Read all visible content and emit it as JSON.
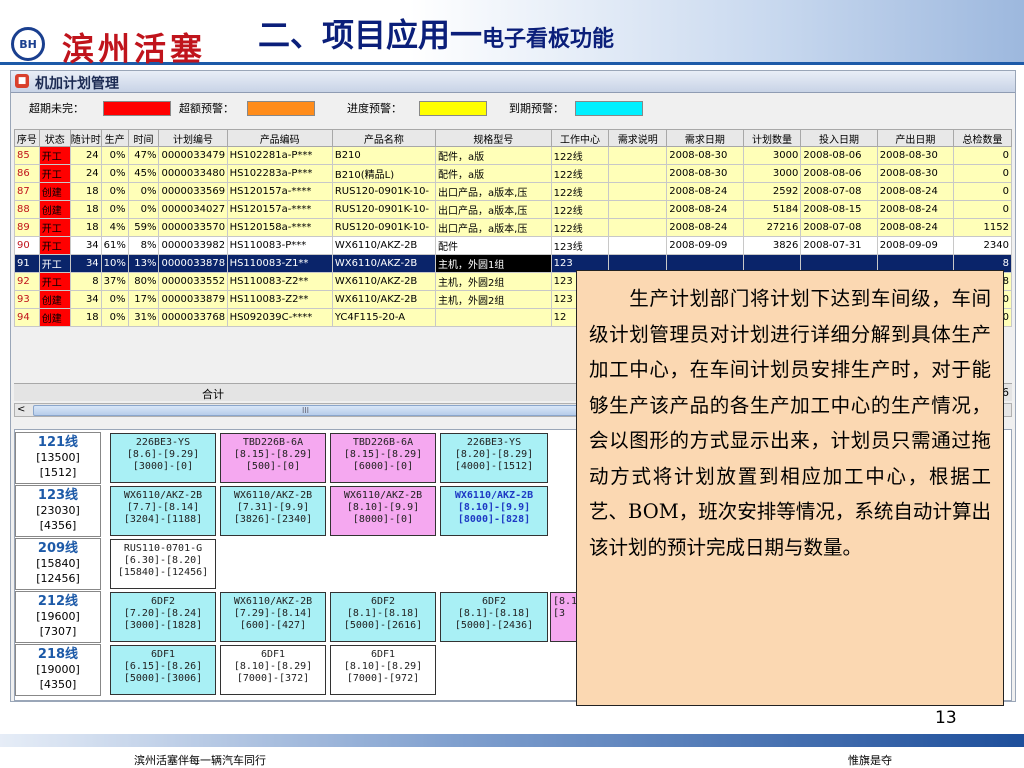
{
  "slide": {
    "logo_badge": "BH",
    "logo_text": "滨州活塞",
    "title_main": "二、项目应用一",
    "title_sub": "电子看板功能",
    "page_number": "13",
    "footer_left": "滨州活塞伴每一辆汽车同行",
    "footer_right": "惟旗是夺"
  },
  "app": {
    "window_title": "机加计划管理",
    "legend": [
      {
        "label": "超期未完：",
        "color": "#ff0000"
      },
      {
        "label": "超额预警：",
        "color": "#ff8c1a"
      },
      {
        "label": "进度预警：",
        "color": "#ffff00"
      },
      {
        "label": "到期预警：",
        "color": "#00f0ff"
      }
    ],
    "columns": [
      "序号",
      "状态",
      "随计时",
      "生产",
      "时间",
      "计划编号",
      "产品编码",
      "产品名称",
      "规格型号",
      "工作中心",
      "需求说明",
      "需求日期",
      "计划数量",
      "投入日期",
      "产出日期",
      "总检数量"
    ],
    "rows": [
      {
        "no": "85",
        "status": "开工",
        "h": "24",
        "prod": "0%",
        "time": "47%",
        "plan": "0000033479",
        "code": "HS102281a-P***",
        "name": "B210",
        "spec": "配件，a版",
        "center": "122线",
        "req": "",
        "due": "2008-08-30",
        "qty": "3000",
        "start": "2008-08-06",
        "end": "2008-08-30",
        "chk": "0"
      },
      {
        "no": "86",
        "status": "开工",
        "h": "24",
        "prod": "0%",
        "time": "45%",
        "plan": "0000033480",
        "code": "HS102283a-P***",
        "name": "B210(精品L)",
        "spec": "配件，a版",
        "center": "122线",
        "req": "",
        "due": "2008-08-30",
        "qty": "3000",
        "start": "2008-08-06",
        "end": "2008-08-30",
        "chk": "0"
      },
      {
        "no": "87",
        "status": "创建",
        "h": "18",
        "prod": "0%",
        "time": "0%",
        "plan": "0000033569",
        "code": "HS120157a-****",
        "name": "RUS120-0901K-10-",
        "spec": "出口产品，a版本,压",
        "center": "122线",
        "req": "",
        "due": "2008-08-24",
        "qty": "2592",
        "start": "2008-07-08",
        "end": "2008-08-24",
        "chk": "0"
      },
      {
        "no": "88",
        "status": "创建",
        "h": "18",
        "prod": "0%",
        "time": "0%",
        "plan": "0000034027",
        "code": "HS120157a-****",
        "name": "RUS120-0901K-10-",
        "spec": "出口产品，a版本,压",
        "center": "122线",
        "req": "",
        "due": "2008-08-24",
        "qty": "5184",
        "start": "2008-08-15",
        "end": "2008-08-24",
        "chk": "0"
      },
      {
        "no": "89",
        "status": "开工",
        "h": "18",
        "prod": "4%",
        "time": "59%",
        "plan": "0000033570",
        "code": "HS120158a-****",
        "name": "RUS120-0901K-10-",
        "spec": "出口产品，a版本,压",
        "center": "122线",
        "req": "",
        "due": "2008-08-24",
        "qty": "27216",
        "start": "2008-07-08",
        "end": "2008-08-24",
        "chk": "1152"
      },
      {
        "no": "90",
        "status": "开工",
        "h": "34",
        "prod": "61%",
        "time": "8%",
        "plan": "0000033982",
        "code": "HS110083-P***",
        "name": "WX6110/AKZ-2B",
        "spec": "配件",
        "center": "123线",
        "req": "",
        "due": "2008-09-09",
        "qty": "3826",
        "start": "2008-07-31",
        "end": "2008-09-09",
        "chk": "2340"
      },
      {
        "no": "91",
        "status": "开工",
        "h": "34",
        "prod": "10%",
        "time": "13%",
        "plan": "0000033878",
        "code": "HS110083-Z1**",
        "name": "WX6110/AKZ-2B",
        "spec": "主机，外圆1组",
        "center": "123",
        "req": "",
        "due": "",
        "qty": "",
        "start": "",
        "end": "",
        "chk": "8"
      },
      {
        "no": "92",
        "status": "开工",
        "h": "8",
        "prod": "37%",
        "time": "80%",
        "plan": "0000033552",
        "code": "HS110083-Z2**",
        "name": "WX6110/AKZ-2B",
        "spec": "主机，外圆2组",
        "center": "123",
        "req": "",
        "due": "",
        "qty": "",
        "start": "",
        "end": "",
        "chk": "8"
      },
      {
        "no": "93",
        "status": "创建",
        "h": "34",
        "prod": "0%",
        "time": "17%",
        "plan": "0000033879",
        "code": "HS110083-Z2**",
        "name": "WX6110/AKZ-2B",
        "spec": "主机，外圆2组",
        "center": "123",
        "req": "",
        "due": "",
        "qty": "",
        "start": "",
        "end": "",
        "chk": "0"
      },
      {
        "no": "94",
        "status": "创建",
        "h": "18",
        "prod": "0%",
        "time": "31%",
        "plan": "0000033768",
        "code": "HS092039C-****",
        "name": "YC4F115-20-A",
        "spec": "",
        "center": "12",
        "req": "",
        "due": "",
        "qty": "",
        "start": "",
        "end": "",
        "chk": "0"
      }
    ],
    "sum_label": "合计",
    "sum_value": "6",
    "scroll_grip": "III",
    "scroll_left": "<",
    "board": {
      "lines": [
        {
          "name": "121线",
          "a": "[13500]",
          "b": "[1512]"
        },
        {
          "name": "123线",
          "a": "[23030]",
          "b": "[4356]"
        },
        {
          "name": "209线",
          "a": "[15840]",
          "b": "[12456]"
        },
        {
          "name": "212线",
          "a": "[19600]",
          "b": "[7307]"
        },
        {
          "name": "218线",
          "a": "[19000]",
          "b": "[4350]"
        }
      ],
      "cards": [
        {
          "l1": "226BE3-YS",
          "l2": "[8.6]-[9.29]",
          "l3": "[3000]-[0]"
        },
        {
          "l1": "TBD226B-6A",
          "l2": "[8.15]-[8.29]",
          "l3": "[500]-[0]"
        },
        {
          "l1": "TBD226B-6A",
          "l2": "[8.15]-[8.29]",
          "l3": "[6000]-[0]"
        },
        {
          "l1": "226BE3-YS",
          "l2": "[8.20]-[8.29]",
          "l3": "[4000]-[1512]"
        },
        {
          "l1": "WX6110/AKZ-2B",
          "l2": "[7.7]-[8.14]",
          "l3": "[3204]-[1188]"
        },
        {
          "l1": "WX6110/AKZ-2B",
          "l2": "[7.31]-[9.9]",
          "l3": "[3826]-[2340]"
        },
        {
          "l1": "WX6110/AKZ-2B",
          "l2": "[8.10]-[9.9]",
          "l3": "[8000]-[0]"
        },
        {
          "l1": "WX6110/AKZ-2B",
          "l2": "[8.10]-[9.9]",
          "l3": "[8000]-[828]"
        },
        {
          "l1": "RUS110-0701-G",
          "l2": "[6.30]-[8.20]",
          "l3": "[15840]-[12456]"
        },
        {
          "l1": "6DF2",
          "l2": "[7.20]-[8.24]",
          "l3": "[3000]-[1828]"
        },
        {
          "l1": "WX6110/AKZ-2B",
          "l2": "[7.29]-[8.14]",
          "l3": "[600]-[427]"
        },
        {
          "l1": "6DF2",
          "l2": "[8.1]-[8.18]",
          "l3": "[5000]-[2616]"
        },
        {
          "l1": "6DF2",
          "l2": "[8.1]-[8.18]",
          "l3": "[5000]-[2436]"
        },
        {
          "l1": "",
          "l2": "[8.1",
          "l3": "[3"
        },
        {
          "l1": "6DF1",
          "l2": "[6.15]-[8.26]",
          "l3": "[5000]-[3006]"
        },
        {
          "l1": "6DF1",
          "l2": "[8.10]-[8.29]",
          "l3": "[7000]-[372]"
        },
        {
          "l1": "6DF1",
          "l2": "[8.10]-[8.29]",
          "l3": "[7000]-[972]"
        }
      ]
    }
  },
  "callout": {
    "text": "　　生产计划部门将计划下达到车间级，车间级计划管理员对计划进行详细分解到具体生产加工中心，在车间计划员安排生产时，对于能够生产该产品的各生产加工中心的生产情况，会以图形的方式显示出来，计划员只需通过拖动方式将计划放置到相应加工中心，根据工艺、BOM，班次安排等情况，系统自动计算出该计划的预计完成日期与数量。"
  }
}
